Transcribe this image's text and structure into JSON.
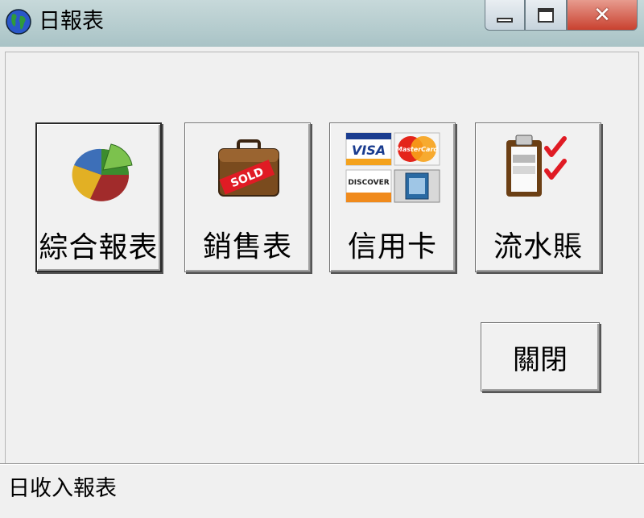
{
  "window": {
    "title": "日報表",
    "icon": "globe-icon"
  },
  "buttons": [
    {
      "label": "綜合報表",
      "icon": "pie-chart-icon"
    },
    {
      "label": "銷售表",
      "icon": "sold-briefcase-icon"
    },
    {
      "label": "信用卡",
      "icon": "credit-cards-icon",
      "card_texts": {
        "visa": "VISA",
        "mastercard": "MasterCard",
        "discover": "DISCOVER"
      }
    },
    {
      "label": "流水賬",
      "icon": "clipboard-checklist-icon"
    }
  ],
  "sold_text": "SOLD",
  "close_button": {
    "label": "關閉"
  },
  "status": {
    "text": "日收入報表"
  }
}
